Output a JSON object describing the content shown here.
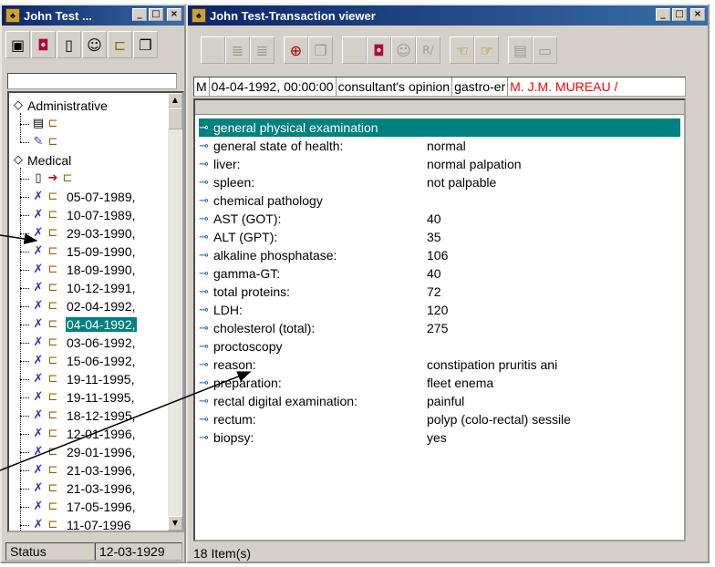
{
  "tree_window": {
    "title": "John Test ...",
    "title_icon": "folder-people-icon",
    "controls": [
      "_",
      "□",
      "×"
    ],
    "toolbar_icons": [
      "patient-icon",
      "color-card-icon",
      "new-document-icon",
      "people-icon",
      "open-folder-icon",
      "copy-documents-icon"
    ],
    "groups": [
      {
        "label": "Administrative",
        "icon": "open-book-icon",
        "children_icons": [
          "form-icon",
          "open-folder-icon",
          "note-icon",
          "open-folder-icon"
        ]
      },
      {
        "label": "Medical",
        "icon": "open-book-icon"
      }
    ],
    "medical_first_row_icons": [
      "document-icon",
      "red-pointer-icon",
      "open-folder-icon"
    ],
    "dates": [
      "05-07-1989,",
      "10-07-1989,",
      "29-03-1990,",
      "15-09-1990,",
      "18-09-1990,",
      "10-12-1991,",
      "02-04-1992,",
      "04-04-1992,",
      "03-06-1992,",
      "15-06-1992,",
      "19-11-1995,",
      "19-11-1995,",
      "18-12-1995,",
      "12-01-1996,",
      "29-01-1996,",
      "21-03-1996,",
      "21-03-1996,",
      "17-05-1996,",
      "11-07-1996"
    ],
    "selected_date_index": 7,
    "status": {
      "label": "Status",
      "date": "12-03-1929"
    }
  },
  "viewer_window": {
    "title": "John Test-Transaction viewer",
    "controls": [
      "_",
      "□",
      "×"
    ],
    "header_fields": [
      "M",
      "04-04-1992, 00:00:00",
      "consultant's opinion",
      "gastro-er",
      "M. J.M. MUREAU /"
    ],
    "accent_color": "#00807f",
    "rows": [
      {
        "key": "general physical examination",
        "value": ""
      },
      {
        "key": "general state of health:",
        "value": "normal"
      },
      {
        "key": "liver:",
        "value": "normal palpation"
      },
      {
        "key": "spleen:",
        "value": "not palpable"
      },
      {
        "key": "chemical pathology",
        "value": ""
      },
      {
        "key": "AST (GOT):",
        "value": "40"
      },
      {
        "key": "ALT (GPT):",
        "value": "35"
      },
      {
        "key": "alkaline phosphatase:",
        "value": "106"
      },
      {
        "key": "gamma-GT:",
        "value": "40"
      },
      {
        "key": "total proteins:",
        "value": "72"
      },
      {
        "key": "LDH:",
        "value": "120"
      },
      {
        "key": "cholesterol (total):",
        "value": "275"
      },
      {
        "key": "proctoscopy",
        "value": ""
      },
      {
        "key": "reason:",
        "value": "constipation pruritis ani"
      },
      {
        "key": "preparation:",
        "value": "fleet enema"
      },
      {
        "key": "rectal digital examination:",
        "value": "painful"
      },
      {
        "key": "rectum:",
        "value": "polyp (colo-rectal) sessile"
      },
      {
        "key": "biopsy:",
        "value": "yes"
      }
    ],
    "selected_row_index": 0,
    "status": "18 Item(s)"
  }
}
